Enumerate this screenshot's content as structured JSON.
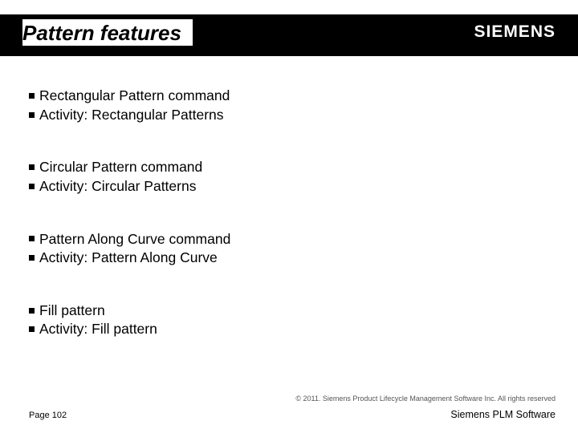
{
  "header": {
    "title": "Pattern features",
    "logo": "SIEMENS"
  },
  "groups": [
    {
      "items": [
        "Rectangular Pattern command",
        "Activity: Rectangular Patterns"
      ]
    },
    {
      "items": [
        "Circular Pattern command",
        "Activity: Circular Patterns"
      ]
    },
    {
      "items": [
        "Pattern Along Curve command",
        "Activity: Pattern Along Curve"
      ]
    },
    {
      "items": [
        "Fill pattern",
        "Activity: Fill pattern"
      ]
    }
  ],
  "footer": {
    "copyright": "© 2011. Siemens Product Lifecycle Management Software Inc. All rights reserved",
    "page": "Page 102",
    "brand": "Siemens PLM Software"
  }
}
